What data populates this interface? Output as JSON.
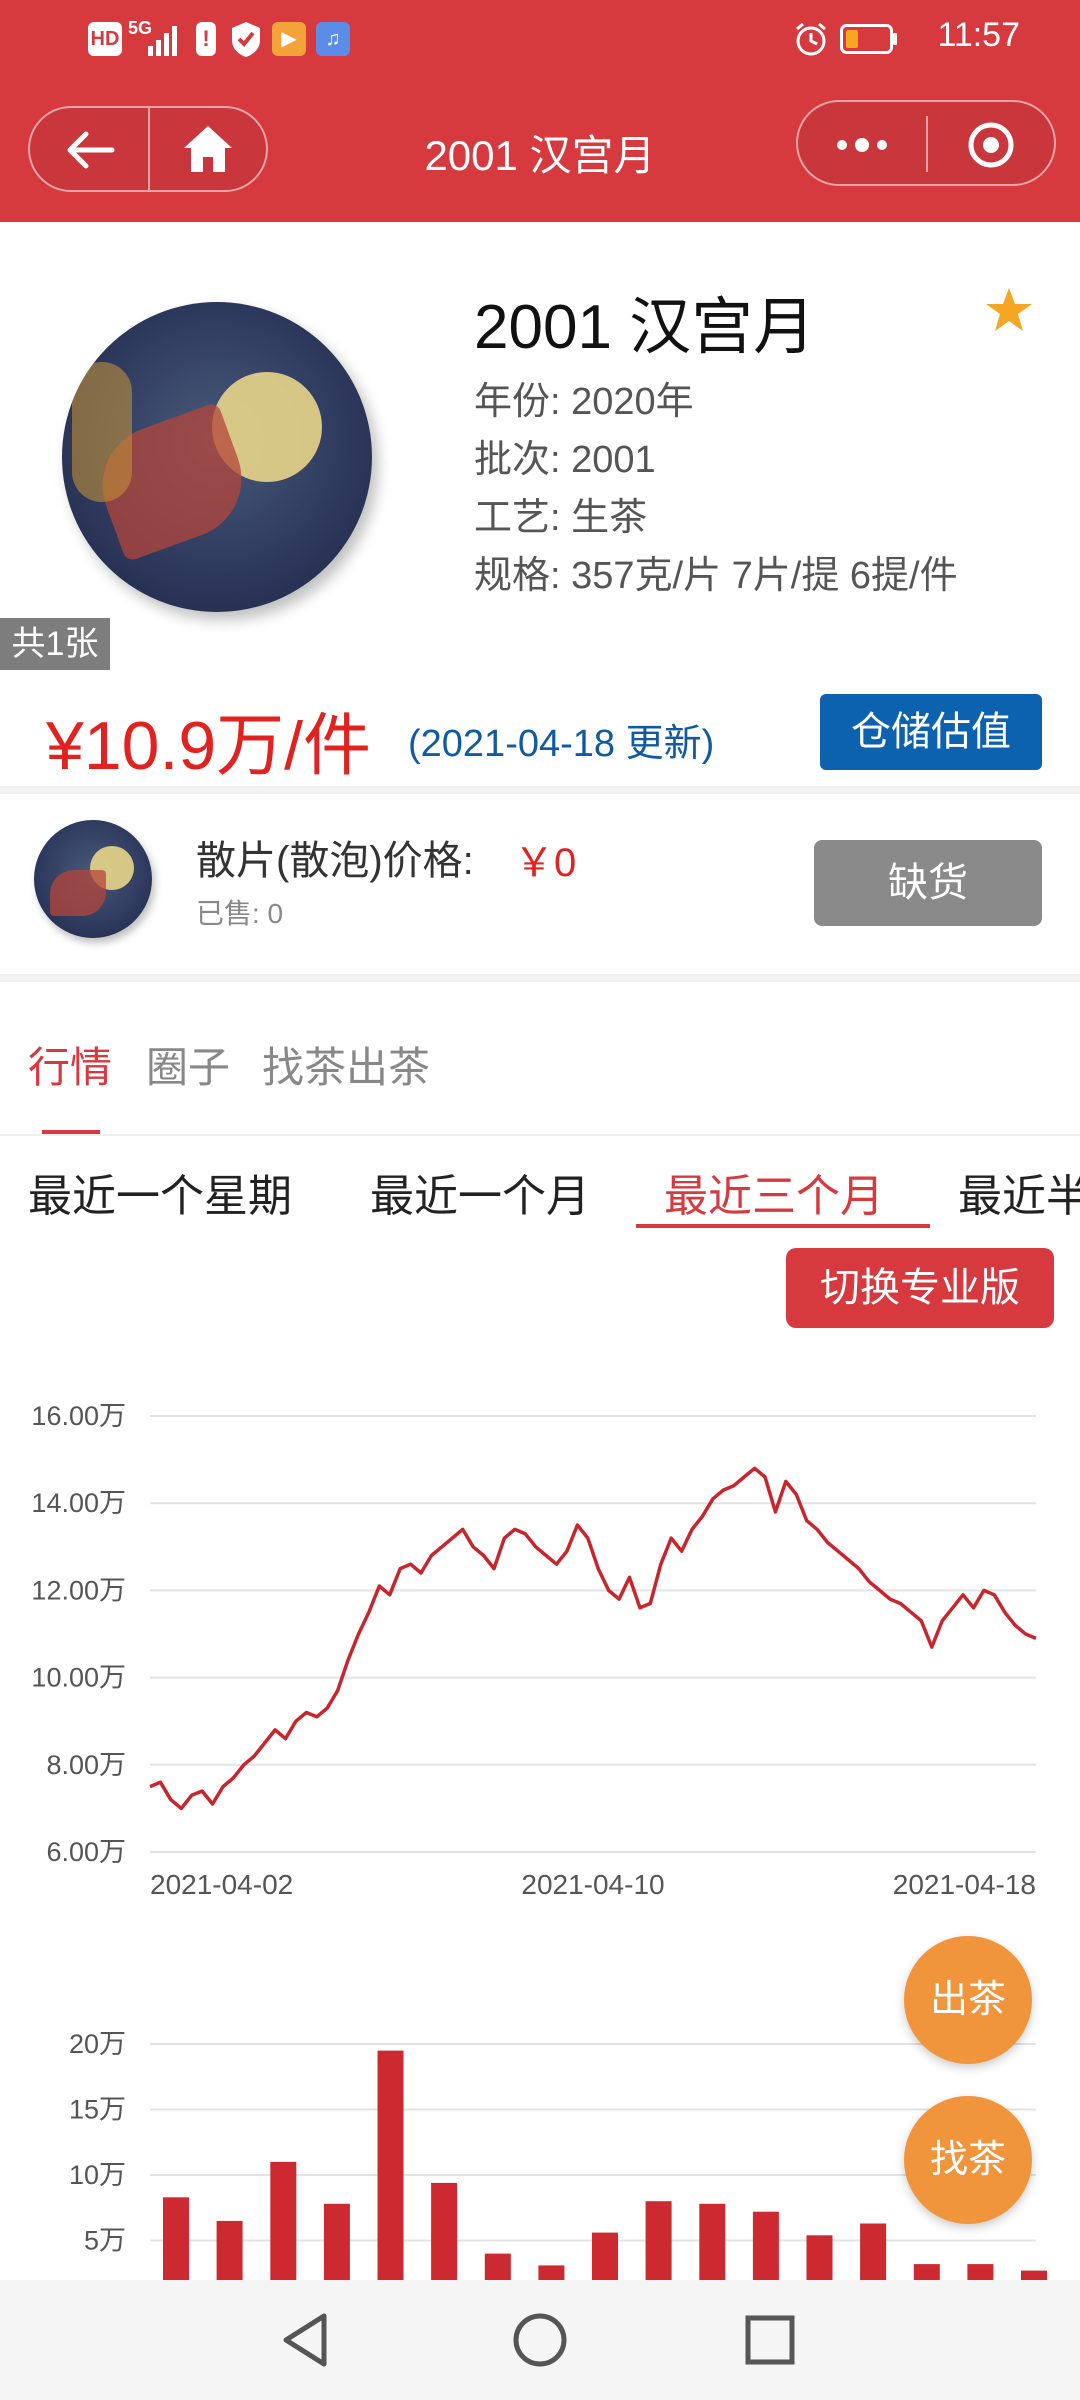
{
  "status_bar": {
    "time": "11:57",
    "hd": "HD",
    "net": "5G"
  },
  "nav": {
    "title": "2001 汉宫月"
  },
  "product": {
    "title": "2001 汉宫月",
    "year": "年份: 2020年",
    "batch": "批次: 2001",
    "craft": "工艺: 生茶",
    "spec": "规格: 357克/片 7片/提 6提/件",
    "image_count": "共1张",
    "price": "¥10.9万/件",
    "updated": "(2021-04-18 更新)",
    "valuation_button": "仓储估值"
  },
  "bulk": {
    "label": "散片(散泡)价格:",
    "price": "￥0",
    "sold": "已售: 0",
    "stock_button": "缺货"
  },
  "tabs": [
    {
      "label": "行情",
      "active": true
    },
    {
      "label": "圈子",
      "active": false
    },
    {
      "label": "找茶出茶",
      "active": false
    }
  ],
  "periods": [
    {
      "label": "最近一个星期",
      "active": false
    },
    {
      "label": "最近一个月",
      "active": false
    },
    {
      "label": "最近三个月",
      "active": true
    },
    {
      "label": "最近半",
      "active": false
    }
  ],
  "pro_button": "切换专业版",
  "fab": {
    "sell": "出茶",
    "find": "找茶"
  },
  "colors": {
    "brand_red": "#d63a3f",
    "price_red": "#e1221f",
    "blue": "#0d62b0",
    "orange": "#f0953c"
  },
  "chart_data": [
    {
      "type": "line",
      "y_tick_labels": [
        "16.00万",
        "14.00万",
        "12.00万",
        "10.00万",
        "8.00万",
        "6.00万"
      ],
      "x_tick_labels": [
        "2021-04-02",
        "2021-04-10",
        "2021-04-18"
      ],
      "ylim": [
        6,
        16
      ],
      "grid": true,
      "series": [
        {
          "values": [
            7.5,
            7.6,
            7.2,
            7.0,
            7.3,
            7.4,
            7.1,
            7.5,
            7.7,
            8.0,
            8.2,
            8.5,
            8.8,
            8.6,
            9.0,
            9.2,
            9.1,
            9.3,
            9.7,
            10.4,
            11.0,
            11.5,
            12.1,
            11.9,
            12.5,
            12.6,
            12.4,
            12.8,
            13.0,
            13.2,
            13.4,
            13.0,
            12.8,
            12.5,
            13.2,
            13.4,
            13.3,
            13.0,
            12.8,
            12.6,
            12.9,
            13.5,
            13.2,
            12.5,
            12.0,
            11.8,
            12.3,
            11.6,
            11.7,
            12.6,
            13.2,
            12.9,
            13.4,
            13.7,
            14.1,
            14.3,
            14.4,
            14.6,
            14.8,
            14.6,
            13.8,
            14.5,
            14.2,
            13.6,
            13.4,
            13.1,
            12.9,
            12.7,
            12.5,
            12.2,
            12.0,
            11.8,
            11.7,
            11.5,
            11.3,
            10.7,
            11.3,
            11.6,
            11.9,
            11.6,
            12.0,
            11.9,
            11.5,
            11.2,
            11.0,
            10.9
          ]
        }
      ]
    },
    {
      "type": "bar",
      "y_tick_labels": [
        "20万",
        "15万",
        "10万",
        "5万"
      ],
      "ylim": [
        0,
        22
      ],
      "grid": true,
      "values": [
        8.3,
        6.5,
        11.0,
        7.8,
        19.5,
        9.4,
        4.0,
        3.1,
        5.6,
        8.0,
        7.8,
        7.2,
        5.4,
        6.3,
        3.2,
        3.2,
        2.7
      ]
    }
  ]
}
